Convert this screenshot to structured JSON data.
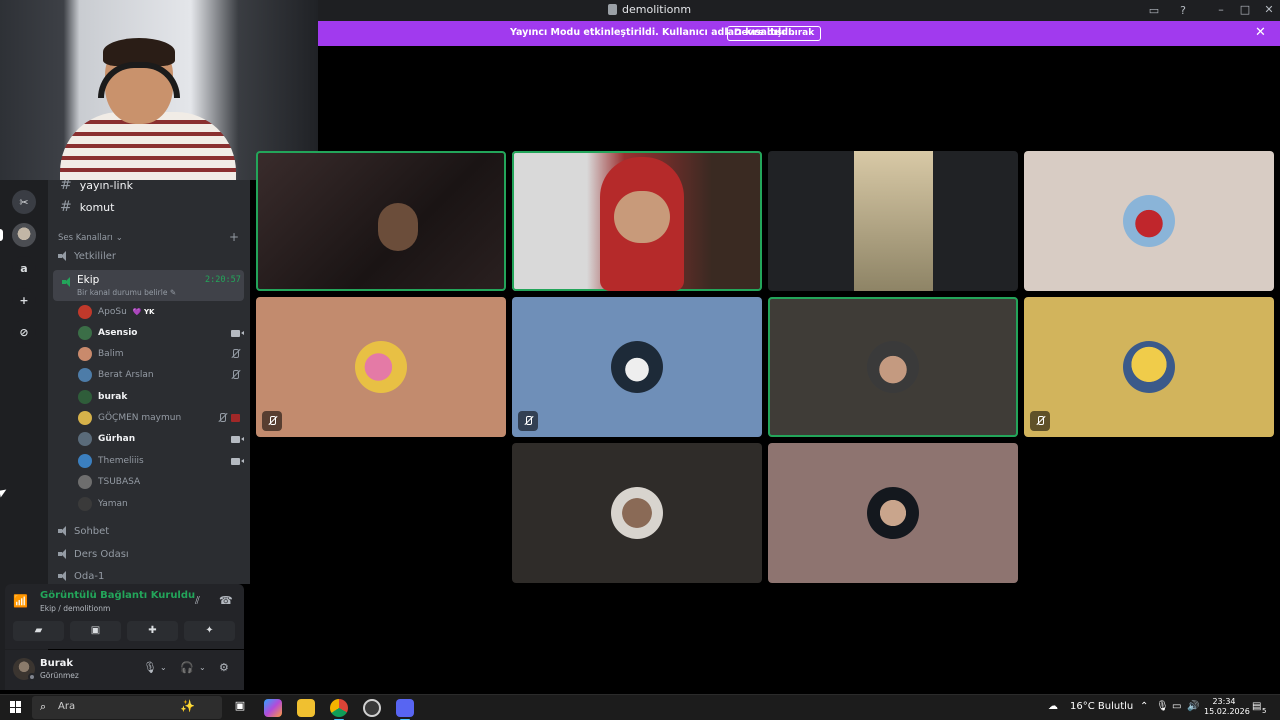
{
  "window": {
    "title": "demolitionm"
  },
  "banner": {
    "message": "Yayıncı Modu etkinleştirildi. Kullanıcı adları kısaltıldı.",
    "button": "Devre dışı bırak"
  },
  "servers": [
    {
      "label": "",
      "icon": "tools-icon"
    },
    {
      "label": "",
      "icon": "server-avatar"
    },
    {
      "label": "a"
    },
    {
      "label": "+",
      "icon": "add-server-icon"
    },
    {
      "label": "⊘",
      "icon": "explore-icon"
    }
  ],
  "text_channels": [
    {
      "name": "yayın-link"
    },
    {
      "name": "komut"
    }
  ],
  "voice_category": "Ses Kanalları",
  "voice_channels": {
    "before": [
      {
        "name": "Yetkililer"
      }
    ],
    "active": {
      "name": "Ekip",
      "timer": "2:20:57",
      "status": "Bir kanal durumu belirle"
    },
    "after": [
      {
        "name": "Sohbet"
      },
      {
        "name": "Ders Odası"
      },
      {
        "name": "Oda-1"
      }
    ]
  },
  "members": [
    {
      "name": "ApoSu",
      "tag": "💜 YK",
      "bold": false,
      "color": "#c0392b"
    },
    {
      "name": "Asensio",
      "bold": true,
      "icons": [
        "camera"
      ],
      "color": "#3b6e47"
    },
    {
      "name": "Balim",
      "bold": false,
      "icons": [
        "muted"
      ],
      "color": "#c98a6c"
    },
    {
      "name": "Berat Arslan",
      "bold": false,
      "icons": [
        "muted"
      ],
      "color": "#4d7ca8"
    },
    {
      "name": "burak",
      "bold": true,
      "color": "#2f5d3a"
    },
    {
      "name": "GÖÇMEN maymun",
      "bold": false,
      "icons": [
        "muted",
        "stream"
      ],
      "color": "#d6b24a"
    },
    {
      "name": "Gürhan",
      "bold": true,
      "icons": [
        "camera"
      ],
      "color": "#5a6b7a"
    },
    {
      "name": "Themeliiis",
      "bold": false,
      "icons": [
        "camera"
      ],
      "color": "#3b7fbf"
    },
    {
      "name": "TSUBASA",
      "bold": false,
      "color": "#6e6e6e"
    },
    {
      "name": "Yaman",
      "bold": false,
      "color": "#3a3a3a"
    }
  ],
  "voice_panel": {
    "title": "Görüntülü Bağlantı Kuruldu",
    "subtitle": "Ekip / demolitionm"
  },
  "user": {
    "name": "Burak",
    "status": "Görünmez"
  },
  "taskbar": {
    "search_placeholder": "Ara",
    "weather": "16°C Bulutlu",
    "time": "23:34",
    "date": "15.02.2026",
    "notification_count": "5"
  },
  "colors": {
    "accent_banner": "#a13aee",
    "speaking": "#23a55a",
    "sidebar": "#2b2d31",
    "rail": "#1e1f22"
  }
}
